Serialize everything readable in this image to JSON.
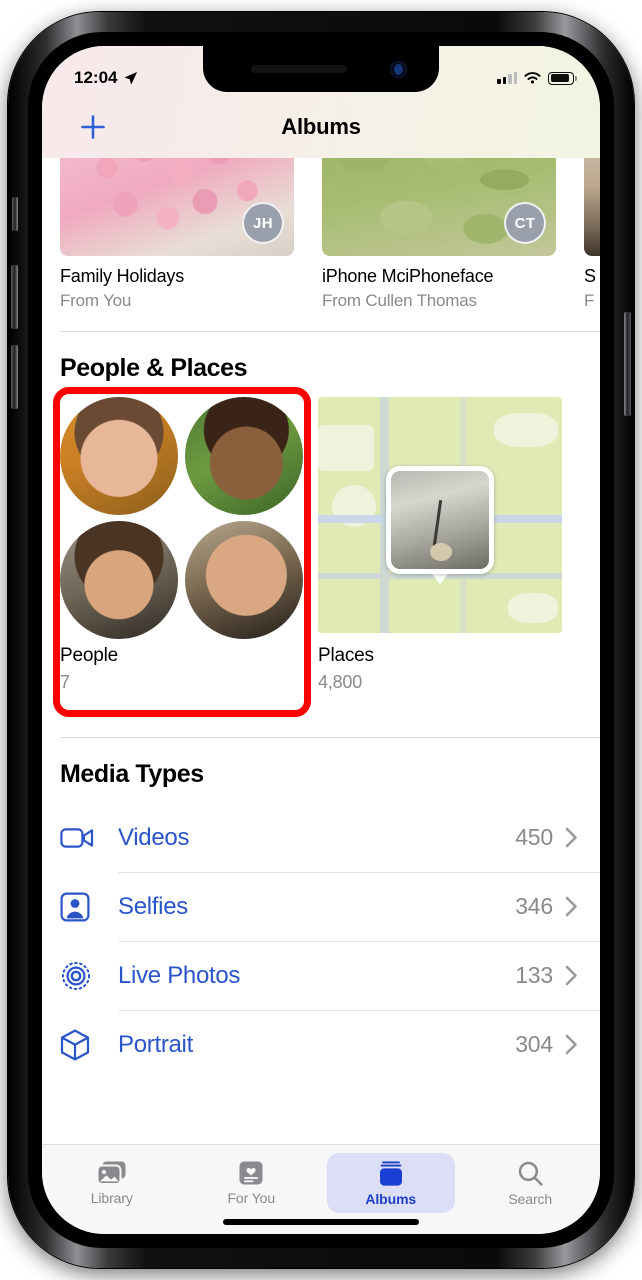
{
  "device": {
    "kind": "iphone",
    "frame_color": "#1a1a1c"
  },
  "status_bar": {
    "time": "12:04",
    "location_icon": "location-arrow-icon",
    "signal_icon": "cellular-signal-icon",
    "signal_bars_active": 2,
    "wifi_icon": "wifi-icon",
    "battery_icon": "battery-icon",
    "battery_level_pct": 78
  },
  "nav_bar": {
    "add_label": "+",
    "add_icon": "plus-icon",
    "title": "Albums"
  },
  "shared_albums": [
    {
      "title": "Family Holidays",
      "subtitle": "From You",
      "avatar_initials": "JH",
      "thumb": "cake"
    },
    {
      "title": "iPhone MciPhoneface",
      "subtitle": "From Cullen Thomas",
      "avatar_initials": "CT",
      "thumb": "grass"
    },
    {
      "title": "S",
      "subtitle": "F",
      "avatar_initials": "",
      "thumb": "wood"
    }
  ],
  "people_places": {
    "heading": "People & Places",
    "people": {
      "title": "People",
      "count": "7",
      "faces": 4
    },
    "places": {
      "title": "Places",
      "count": "4,800"
    },
    "annotation_color": "#ff0000",
    "annotation_target": "people-tile"
  },
  "media_types": {
    "heading": "Media Types",
    "rows": [
      {
        "label": "Videos",
        "count": "450",
        "icon": "video-camera-icon"
      },
      {
        "label": "Selfies",
        "count": "346",
        "icon": "selfie-person-icon"
      },
      {
        "label": "Live Photos",
        "count": "133",
        "icon": "live-photo-icon"
      },
      {
        "label": "Portrait",
        "count": "304",
        "icon": "portrait-cube-icon"
      }
    ],
    "chevron_icon": "chevron-right-icon",
    "accent_color": "#2a55c9"
  },
  "tab_bar": {
    "tabs": [
      {
        "label": "Library",
        "icon": "photo-stack-icon",
        "selected": false
      },
      {
        "label": "For You",
        "icon": "for-you-card-icon",
        "selected": false
      },
      {
        "label": "Albums",
        "icon": "albums-book-icon",
        "selected": true
      },
      {
        "label": "Search",
        "icon": "magnifier-icon",
        "selected": false
      }
    ],
    "selected_bg": "#dcdef6",
    "selected_color": "#1d3fc4"
  }
}
